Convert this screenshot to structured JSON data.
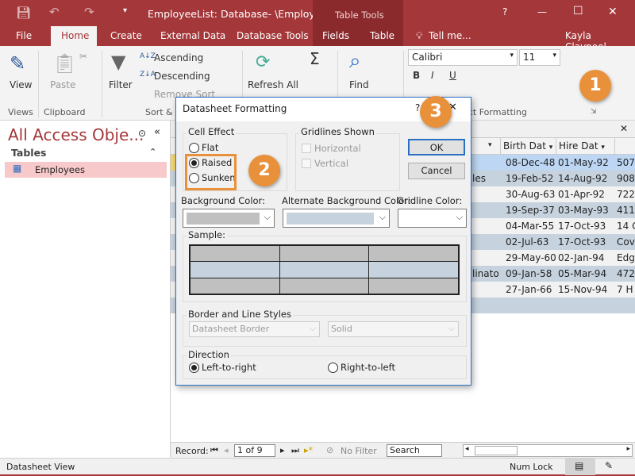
{
  "titlebar": {
    "title": "EmployeeList: Database- \\Employee...",
    "context_tab": "Table Tools",
    "help": "?",
    "minimize": "—",
    "maximize": "☐",
    "close": "✕",
    "user": "Kayla Claypool",
    "tell_me": "Tell me..."
  },
  "tabs": [
    "File",
    "Home",
    "Create",
    "External Data",
    "Database Tools",
    "Fields",
    "Table"
  ],
  "ribbon": {
    "view": "View",
    "paste": "Paste",
    "filter": "Filter",
    "ascending": "Ascending",
    "descending": "Descending",
    "remove_sort": "Remove Sort",
    "refresh": "Refresh All",
    "find": "Find",
    "font": "Calibri",
    "font_size": "11",
    "groups": [
      "Views",
      "Clipboard",
      "Sort & Filter",
      "Text Formatting"
    ]
  },
  "nav": {
    "title": "All Access Obje...",
    "section": "Tables",
    "items": [
      {
        "label": "Employees"
      }
    ]
  },
  "sheet": {
    "columns": [
      "Birth Dat",
      "Hire Dat"
    ],
    "rows": [
      {
        "c0": "",
        "birth": "08-Dec-48",
        "hire": "01-May-92",
        "addr": "507"
      },
      {
        "c0": "les",
        "birth": "19-Feb-52",
        "hire": "14-Aug-92",
        "addr": "908"
      },
      {
        "c0": "",
        "birth": "30-Aug-63",
        "hire": "01-Apr-92",
        "addr": "722"
      },
      {
        "c0": "",
        "birth": "19-Sep-37",
        "hire": "03-May-93",
        "addr": "411"
      },
      {
        "c0": "",
        "birth": "04-Mar-55",
        "hire": "17-Oct-93",
        "addr": "14 C"
      },
      {
        "c0": "",
        "birth": "02-Jul-63",
        "hire": "17-Oct-93",
        "addr": "Cov"
      },
      {
        "c0": "",
        "birth": "29-May-60",
        "hire": "02-Jan-94",
        "addr": "Edg"
      },
      {
        "c0": "linato",
        "birth": "09-Jan-58",
        "hire": "05-Mar-94",
        "addr": "472"
      },
      {
        "c0": "",
        "birth": "27-Jan-66",
        "hire": "15-Nov-94",
        "addr": "7 H"
      }
    ]
  },
  "dialog": {
    "title": "Datasheet Formatting",
    "help": "?",
    "close": "✕",
    "cell_effect": {
      "legend": "Cell Effect",
      "options": [
        "Flat",
        "Raised",
        "Sunken"
      ],
      "selected": "Raised"
    },
    "gridlines": {
      "legend": "Gridlines Shown",
      "horizontal": "Horizontal",
      "vertical": "Vertical"
    },
    "ok": "OK",
    "cancel": "Cancel",
    "bg_label": "Background Color:",
    "alt_bg_label": "Alternate Background Color:",
    "grid_label": "Gridline Color:",
    "colors": {
      "background": "#c0c0c0",
      "alternate": "#c6d2de",
      "gridline": "#ffffff"
    },
    "sample_label": "Sample:",
    "border_legend": "Border and Line Styles",
    "border_value": "Datasheet Border",
    "line_value": "Solid",
    "direction_legend": "Direction",
    "ltr": "Left-to-right",
    "rtl": "Right-to-left",
    "direction_selected": "Left-to-right"
  },
  "callouts": [
    "1",
    "2",
    "3"
  ],
  "recnav": {
    "label": "Record:",
    "position": "1 of 9",
    "filter": "No Filter",
    "search": "Search"
  },
  "status": {
    "view": "Datasheet View",
    "numlock": "Num Lock"
  },
  "colors": {
    "accent": "#a4373a",
    "callout": "#e8903a",
    "selected_row": "#bcd6f3"
  }
}
